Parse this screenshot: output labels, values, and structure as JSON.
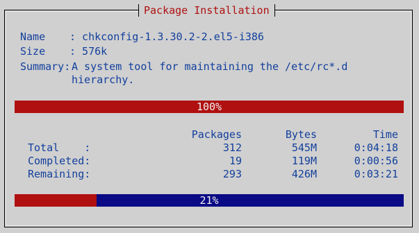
{
  "window": {
    "title": "Package Installation"
  },
  "package": {
    "name_label": "Name",
    "name_value": ": chkconfig-1.3.30.2-2.el5-i386",
    "size_label": "Size",
    "size_value": ": 576k",
    "summary_label": "Summary:",
    "summary_value": "A system tool for maintaining the /etc/rc*.d",
    "summary_continuation": "hierarchy."
  },
  "package_progress": {
    "label": "100%",
    "fraction": 1.0
  },
  "stats": {
    "headers": {
      "packages": "Packages",
      "bytes": "Bytes",
      "time": "Time"
    },
    "rows": [
      {
        "label": "Total    :",
        "packages": "312",
        "bytes": "545M",
        "time": "0:04:18"
      },
      {
        "label": "Completed:",
        "packages": "19",
        "bytes": "119M",
        "time": "0:00:56"
      },
      {
        "label": "Remaining:",
        "packages": "293",
        "bytes": "426M",
        "time": "0:03:21"
      }
    ]
  },
  "overall_progress": {
    "label": "21%",
    "fraction": 0.21
  },
  "colors": {
    "background": "#d0d0d0",
    "text_blue": "#123f9c",
    "title_red": "#b01010",
    "bar_fill_red": "#b01010",
    "bar_remaining_blue": "#0a0a86",
    "bar_text": "#f0f0f0"
  }
}
